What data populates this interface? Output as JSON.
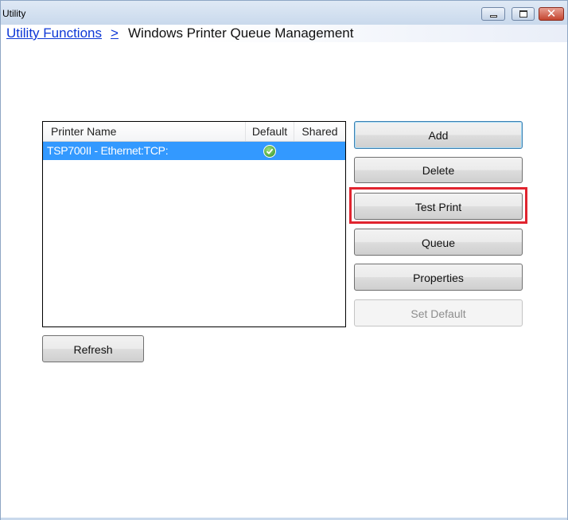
{
  "window": {
    "title": "Utility",
    "controls": {
      "minimize": "minimize-icon",
      "maximize": "maximize-icon",
      "close": "close-icon",
      "close_glyph": "✕"
    }
  },
  "breadcrumb": {
    "parent": "Utility Functions",
    "separator": ">",
    "current": "Windows Printer Queue Management"
  },
  "printer_list": {
    "columns": [
      "Printer Name",
      "Default",
      "Shared"
    ],
    "rows": [
      {
        "name": "TSP700II - Ethernet:TCP:",
        "default": true,
        "default_icon": "check-circle-icon",
        "shared": ""
      }
    ],
    "selected_row": 0
  },
  "actions": {
    "add": "Add",
    "delete": "Delete",
    "test_print": "Test Print",
    "queue": "Queue",
    "properties": "Properties",
    "set_default": "Set Default",
    "refresh": "Refresh"
  },
  "highlight_color": "#e0242f",
  "selection_color": "#3399ff"
}
